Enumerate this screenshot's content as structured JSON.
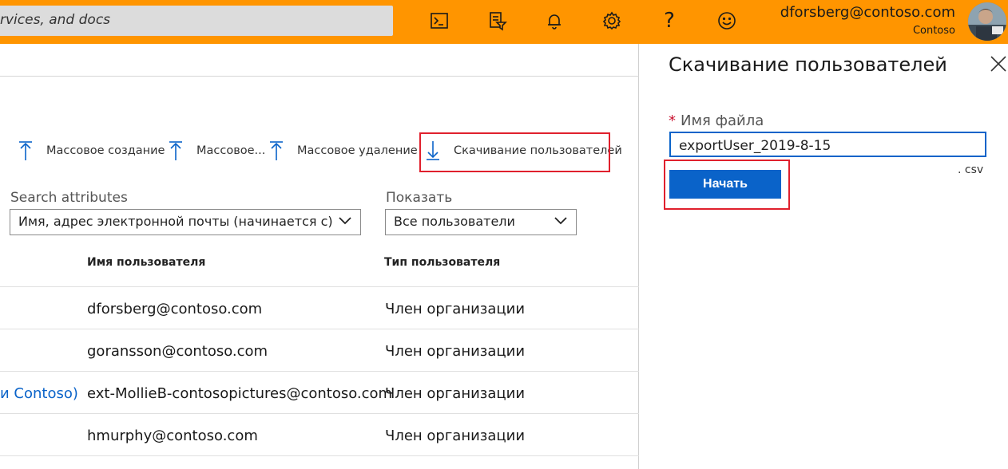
{
  "topbar": {
    "search_text": "rvices, and docs",
    "icons": [
      "cloud-shell-icon",
      "directory-filter-icon",
      "notifications-icon",
      "settings-icon",
      "help-icon",
      "feedback-icon"
    ],
    "user_email": "dforsberg@contoso.com",
    "user_tenant": "Contoso",
    "color": "#ff9500"
  },
  "toolbar": {
    "bulk_create": "Массовое создание",
    "bulk_invite": "Массовое...",
    "bulk_delete": "Массовое удаление",
    "download_users": "Скачивание пользователей"
  },
  "filters": {
    "search_label": "Search attributes",
    "search_value": "Имя, адрес электронной почты (начинается с)",
    "show_label": "Показать",
    "show_value": "Все пользователи"
  },
  "table": {
    "columns": [
      "Имя пользователя",
      "Тип пользователя"
    ],
    "rows": [
      {
        "prefix": "",
        "username": "dforsberg@contoso.com",
        "type": "Член организации"
      },
      {
        "prefix": "",
        "username": "goransson@contoso.com",
        "type": "Член организации"
      },
      {
        "prefix": "и Contoso)",
        "username": "ext-MollieB-contosopictures@contoso.com",
        "type": "Член организации"
      },
      {
        "prefix": "",
        "username": "hmurphy@contoso.com",
        "type": "Член организации"
      }
    ]
  },
  "panel": {
    "title": "Скачивание пользователей",
    "file_label": "Имя файла",
    "required_mark": "*",
    "file_value": "exportUser_2019-8-15",
    "suffix": ". csv",
    "start_button": "Начать"
  },
  "colors": {
    "accent": "#0a63c9",
    "highlight": "#e0202d",
    "required": "#c8102e"
  }
}
